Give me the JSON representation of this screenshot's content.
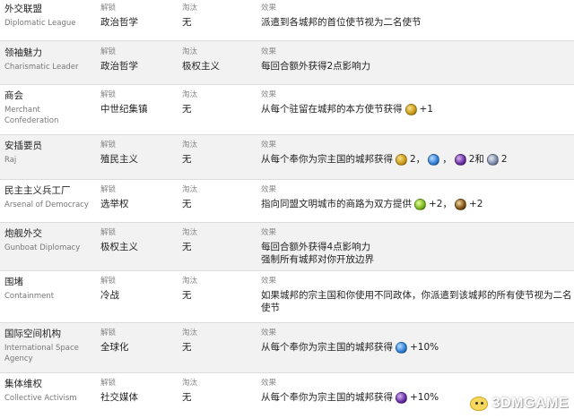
{
  "labels": {
    "unlock": "解锁",
    "obsolete": "淘汰",
    "effect": "效果"
  },
  "rows": [
    {
      "name_cn": "外交联盟",
      "name_en": "Diplomatic League",
      "unlock": "政治哲学",
      "obsolete": "无",
      "effect": "派遣到各城邦的首位使节视为二名使节"
    },
    {
      "name_cn": "领袖魅力",
      "name_en": "Charismatic Leader",
      "unlock": "政治哲学",
      "obsolete": "极权主义",
      "effect": "每回合额外获得2点影响力"
    },
    {
      "name_cn": "商会",
      "name_en": "Merchant Confederation",
      "unlock": "中世纪集镇",
      "obsolete": "无",
      "effect": "从每个驻留在城邦的本方使节获得",
      "effect_suffix": "+1"
    },
    {
      "name_cn": "安插要员",
      "name_en": "Raj",
      "unlock": "殖民主义",
      "obsolete": "无",
      "effect": "从每个奉你为宗主国的城邦获得",
      "tok1": "2，",
      "tok2": "，",
      "tok3": "2和",
      "tok4": "2"
    },
    {
      "name_cn": "民主主义兵工厂",
      "name_en": "Arsenal of Democracy",
      "unlock": "选举权",
      "obsolete": "无",
      "effect": "指向同盟文明城市的商路为双方提供",
      "tok1": "+2，",
      "tok2": "+2"
    },
    {
      "name_cn": "炮舰外交",
      "name_en": "Gunboat Diplomacy",
      "unlock": "极权主义",
      "obsolete": "无",
      "effect": "每回合额外获得4点影响力",
      "effect2": "强制所有城邦对你开放边界"
    },
    {
      "name_cn": "围堵",
      "name_en": "Containment",
      "unlock": "冷战",
      "obsolete": "无",
      "effect": "如果城邦的宗主国和你使用不同政体，你派遣到该城邦的所有使节视为二名",
      "effect2": "使节"
    },
    {
      "name_cn": "国际空间机构",
      "name_en": "International Space Agency",
      "unlock": "全球化",
      "obsolete": "无",
      "effect": "从每个奉你为宗主国的城邦获得",
      "effect_suffix": "+10%"
    },
    {
      "name_cn": "集体维权",
      "name_en": "Collective Activism",
      "unlock": "社交媒体",
      "obsolete": "无",
      "effect": "从每个奉你为宗主国的城邦获得",
      "effect_suffix": "+10%"
    }
  ],
  "icons": {
    "envoy": "envoy-icon",
    "culture": "culture-icon",
    "science": "science-icon",
    "religion": "faith-icon",
    "production": "production-icon",
    "gold": "gold-icon"
  },
  "watermark": {
    "main": "3DMGAME",
    "accent_char": "3"
  }
}
